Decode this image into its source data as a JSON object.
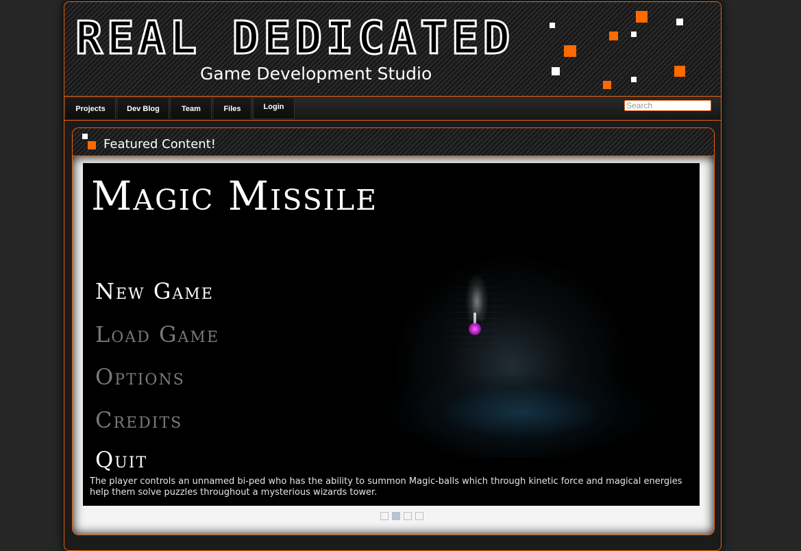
{
  "header": {
    "logo_text": "REAL DEDICATED",
    "tagline": "Game Development Studio"
  },
  "nav": {
    "items": [
      {
        "label": "Projects"
      },
      {
        "label": "Dev Blog"
      },
      {
        "label": "Team"
      },
      {
        "label": "Files"
      },
      {
        "label": "Login"
      }
    ],
    "search_placeholder": "Search"
  },
  "featured": {
    "title": "Featured Content!",
    "slide": {
      "game_title": "Magic Missile",
      "menu": [
        "New Game",
        "Load Game",
        "Options",
        "Credits",
        "Quit"
      ],
      "caption": "The player controls an unnamed bi-ped who has the ability to summon Magic-balls which through kinetic force and magical energies help them solve puzzles throughout a mysterious wizards tower."
    },
    "slider": {
      "total": 4,
      "active_index": 1
    }
  },
  "colors": {
    "accent": "#ff6a00",
    "border": "#e8630f",
    "background": "#262626"
  }
}
